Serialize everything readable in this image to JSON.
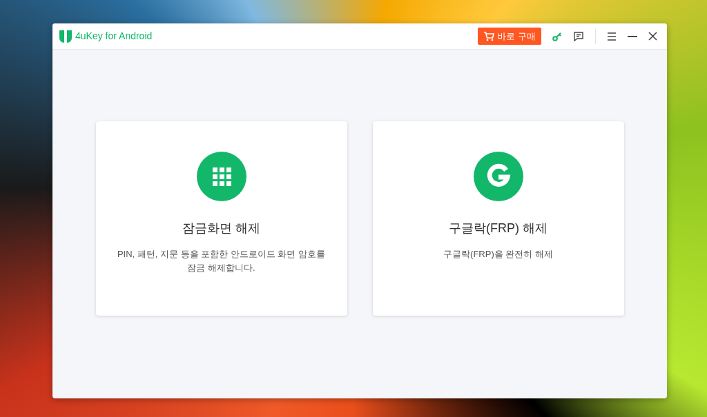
{
  "window": {
    "title": "4uKey for Android",
    "buy_button": "바로 구매"
  },
  "cards": [
    {
      "kind": "keypad",
      "title": "잠금화면 해제",
      "description": "PIN, 패턴, 지문 등을 포함한 안드로이드 화면 암호를 잠금 해제합니다."
    },
    {
      "kind": "google",
      "title": "구글락(FRP) 해제",
      "description": "구글락(FRP)을 완전히 해제"
    }
  ]
}
